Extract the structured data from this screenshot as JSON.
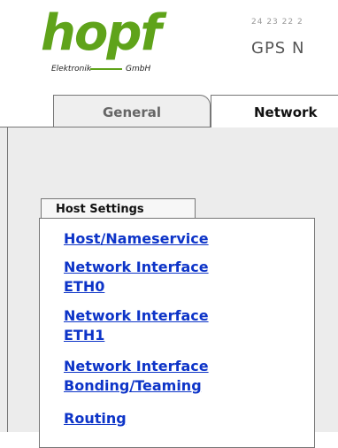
{
  "header": {
    "logo_main": "hopf",
    "logo_sub_left": "Elektronik",
    "logo_sub_right": "GmbH",
    "product_digits": "24 23 22 2",
    "product_title": "GPS N"
  },
  "tabs": [
    {
      "label": "General",
      "active": false
    },
    {
      "label": "Network",
      "active": true
    }
  ],
  "host_settings": {
    "tab_label": "Host Settings",
    "links": [
      {
        "lines": [
          "Host/Nameservice"
        ]
      },
      {
        "lines": [
          "Network Interface",
          "ETH0"
        ]
      },
      {
        "lines": [
          "Network Interface",
          "ETH1"
        ]
      },
      {
        "lines": [
          "Network Interface",
          "Bonding/Teaming"
        ]
      },
      {
        "lines": [
          "Routing"
        ]
      }
    ]
  },
  "colors": {
    "brand_green": "#5fa31a",
    "link_blue": "#0d34c8",
    "pane_gray": "#ececec"
  }
}
